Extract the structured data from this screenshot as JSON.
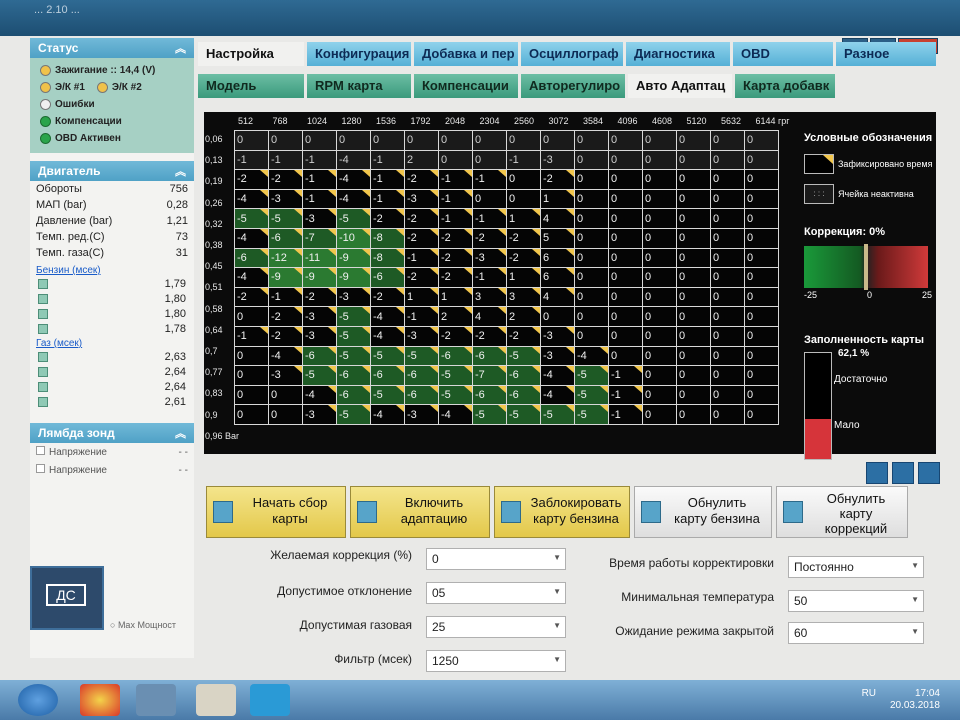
{
  "window": {
    "title": "... 2.10 ..."
  },
  "status": {
    "header": "Статус",
    "ignition": "Зажигание :: 14,4 (V)",
    "ek1": "Э/К #1",
    "ek2": "Э/К #2",
    "errors": "Ошибки",
    "compensation": "Компенсации",
    "obd": "OBD Активен"
  },
  "engine": {
    "header": "Двигатель",
    "rows": [
      {
        "label": "Обороты",
        "value": "756"
      },
      {
        "label": "МАП (bar)",
        "value": "0,28"
      },
      {
        "label": "Давление (bar)",
        "value": "1,21"
      },
      {
        "label": "Темп. ред.(C)",
        "value": "73"
      },
      {
        "label": "Темп. газа(C)",
        "value": "31"
      }
    ],
    "petrol_label": "Бензин (мсек)",
    "petrol": [
      "1,79",
      "1,80",
      "1,80",
      "1,78"
    ],
    "gas_label": "Газ (мсек)",
    "gas": [
      "2,63",
      "2,64",
      "2,64",
      "2,61"
    ]
  },
  "lambda": {
    "header": "Лямбда зонд",
    "rows": [
      {
        "label": "Напряжение",
        "value": "- -"
      },
      {
        "label": "Напряжение",
        "value": "- -"
      }
    ]
  },
  "logo": {
    "text": "ДС",
    "max_power": "Max Мощност"
  },
  "tabs_top": [
    "Настройка",
    "Конфигурация",
    "Добавка и пер",
    "Осциллограф",
    "Диагностика",
    "OBD",
    "Разное"
  ],
  "tabs_sub": [
    "Модель",
    "RPM карта",
    "Компенсации",
    "Авторегулиро",
    "Авто Адаптац",
    "Карта добавк"
  ],
  "grid": {
    "x_headers": [
      "512",
      "768",
      "1024",
      "1280",
      "1536",
      "1792",
      "2048",
      "2304",
      "2560",
      "3072",
      "3584",
      "4096",
      "4608",
      "5120",
      "5632",
      "6144 грг"
    ],
    "y_headers": [
      "0,06",
      "0,13",
      "0,19",
      "0,26",
      "0,32",
      "0,38",
      "0,45",
      "0,51",
      "0,58",
      "0,64",
      "0,7",
      "0,77",
      "0,83",
      "0,9",
      "0,96 Bar"
    ],
    "rows": [
      [
        "0",
        "0",
        "0",
        "0",
        "0",
        "0",
        "0",
        "0",
        "0",
        "0",
        "0",
        "0",
        "0",
        "0",
        "0",
        "0"
      ],
      [
        "-1",
        "-1",
        "-1",
        "-4",
        "-1",
        "2",
        "0",
        "0",
        "-1",
        "-3",
        "0",
        "0",
        "0",
        "0",
        "0",
        "0"
      ],
      [
        "-2",
        "-2",
        "-1",
        "-4",
        "-1",
        "-2",
        "-1",
        "-1",
        "0",
        "-2",
        "0",
        "0",
        "0",
        "0",
        "0",
        "0"
      ],
      [
        "-4",
        "-3",
        "-1",
        "-4",
        "-1",
        "-3",
        "-1",
        "0",
        "0",
        "1",
        "0",
        "0",
        "0",
        "0",
        "0",
        "0"
      ],
      [
        "-5",
        "-5",
        "-3",
        "-5",
        "-2",
        "-2",
        "-1",
        "-1",
        "1",
        "4",
        "0",
        "0",
        "0",
        "0",
        "0",
        "0"
      ],
      [
        "-4",
        "-6",
        "-7",
        "-10",
        "-8",
        "-2",
        "-2",
        "-2",
        "-2",
        "5",
        "0",
        "0",
        "0",
        "0",
        "0",
        "0"
      ],
      [
        "-6",
        "-12",
        "-11",
        "-9",
        "-8",
        "-1",
        "-2",
        "-3",
        "-2",
        "6",
        "0",
        "0",
        "0",
        "0",
        "0",
        "0"
      ],
      [
        "-4",
        "-9",
        "-9",
        "-9",
        "-6",
        "-2",
        "-2",
        "-1",
        "1",
        "6",
        "0",
        "0",
        "0",
        "0",
        "0",
        "0"
      ],
      [
        "-2",
        "-1",
        "-2",
        "-3",
        "-2",
        "1",
        "1",
        "3",
        "3",
        "4",
        "0",
        "0",
        "0",
        "0",
        "0",
        "0"
      ],
      [
        "0",
        "-2",
        "-3",
        "-5",
        "-4",
        "-1",
        "2",
        "4",
        "2",
        "0",
        "0",
        "0",
        "0",
        "0",
        "0",
        "0"
      ],
      [
        "-1",
        "-2",
        "-3",
        "-5",
        "-4",
        "-3",
        "-2",
        "-2",
        "-2",
        "-3",
        "0",
        "0",
        "0",
        "0",
        "0",
        "0"
      ],
      [
        "0",
        "-4",
        "-6",
        "-5",
        "-5",
        "-5",
        "-6",
        "-6",
        "-5",
        "-3",
        "-4",
        "0",
        "0",
        "0",
        "0",
        "0"
      ],
      [
        "0",
        "-3",
        "-5",
        "-6",
        "-6",
        "-6",
        "-5",
        "-7",
        "-6",
        "-4",
        "-5",
        "-1",
        "0",
        "0",
        "0",
        "0"
      ],
      [
        "0",
        "0",
        "-4",
        "-6",
        "-5",
        "-6",
        "-5",
        "-6",
        "-6",
        "-4",
        "-5",
        "-1",
        "0",
        "0",
        "0",
        "0"
      ],
      [
        "0",
        "0",
        "-3",
        "-5",
        "-4",
        "-3",
        "-4",
        "-5",
        "-5",
        "-5",
        "-5",
        "-1",
        "0",
        "0",
        "0",
        "0"
      ]
    ]
  },
  "legend": {
    "title": "Условные обозначения",
    "fixed": "Зафиксировано время",
    "inactive": "Ячейка неактивна",
    "correction_label": "Коррекция: 0%",
    "corr_min": "-25",
    "corr_mid": "0",
    "corr_max": "25",
    "fill_label": "Заполненность карты",
    "fill_pct": "62,1 %",
    "fill_fraction": 0.62,
    "enough": "Достаточно",
    "little": "Мало"
  },
  "buttons": {
    "start": [
      "Начать сбор",
      "карты"
    ],
    "enable": [
      "Включить",
      "адаптацию"
    ],
    "block": [
      "Заблокировать",
      "карту бензина"
    ],
    "reset_petrol": [
      "Обнулить",
      "карту бензина"
    ],
    "reset_corr": [
      "Обнулить",
      "карту",
      "коррекций"
    ]
  },
  "settings": {
    "desired_corr": {
      "label": "Желаемая коррекция (%)",
      "value": "0"
    },
    "deviation": {
      "label": "Допустимое отклонение",
      "value": "05"
    },
    "gas_allowed": {
      "label": "Допустимая газовая",
      "value": "25"
    },
    "filter": {
      "label": "Фильтр (мсек)",
      "value": "1250"
    },
    "work_time": {
      "label": "Время работы корректировки",
      "value": "Постоянно"
    },
    "min_temp": {
      "label": "Минимальная температура",
      "value": "50"
    },
    "wait_mode": {
      "label": "Ожидание режима закрытой",
      "value": "60"
    }
  },
  "taskbar": {
    "lang": "RU",
    "time": "17:04",
    "date": "20.03.2018"
  }
}
